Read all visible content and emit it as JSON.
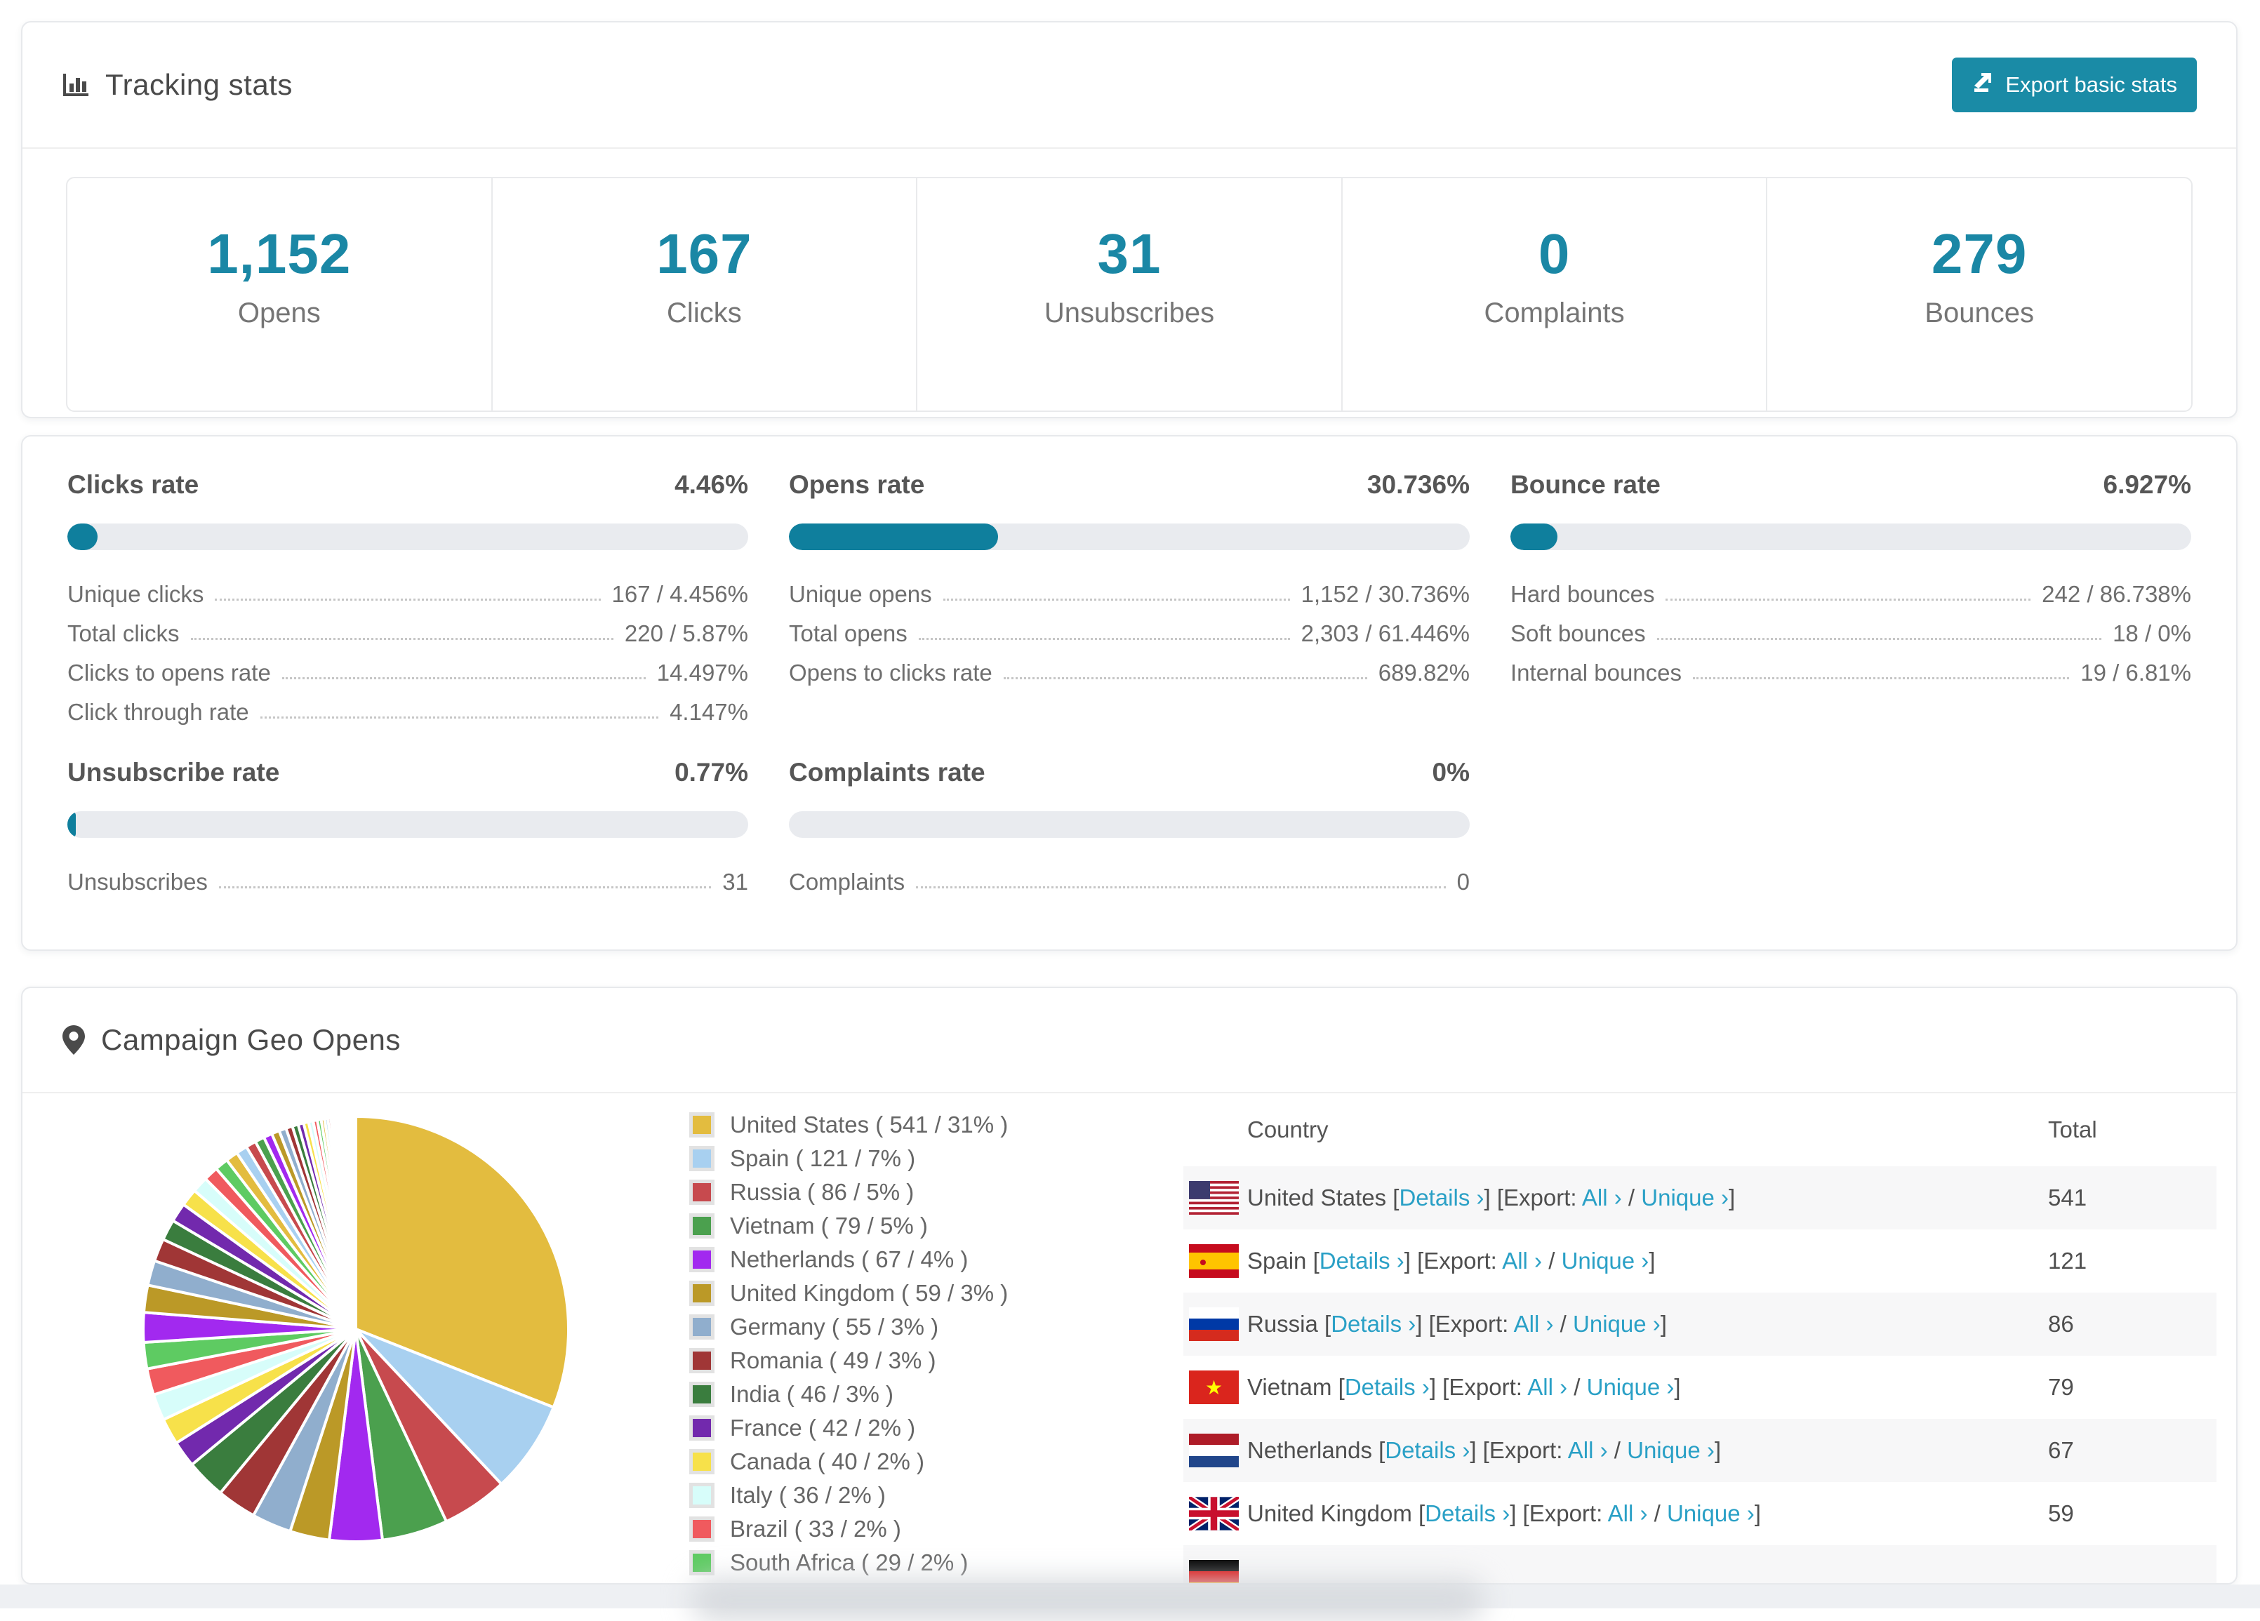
{
  "colors": {
    "accent": "#1a87a5",
    "bar_fill": "#0f7f9d",
    "button_bg": "#1a8ba6",
    "link": "#2aa0c6"
  },
  "header": {
    "title": "Tracking stats",
    "export_label": "Export basic stats"
  },
  "stats": [
    {
      "value": "1,152",
      "label": "Opens"
    },
    {
      "value": "167",
      "label": "Clicks"
    },
    {
      "value": "31",
      "label": "Unsubscribes"
    },
    {
      "value": "0",
      "label": "Complaints"
    },
    {
      "value": "279",
      "label": "Bounces"
    }
  ],
  "rates": [
    {
      "title": "Clicks rate",
      "value": "4.46%",
      "pct": 4.46,
      "rows": [
        {
          "label": "Unique clicks",
          "value": "167 / 4.456%"
        },
        {
          "label": "Total clicks",
          "value": "220 / 5.87%"
        },
        {
          "label": "Clicks to opens rate",
          "value": "14.497%"
        },
        {
          "label": "Click through rate",
          "value": "4.147%"
        }
      ]
    },
    {
      "title": "Opens rate",
      "value": "30.736%",
      "pct": 30.736,
      "rows": [
        {
          "label": "Unique opens",
          "value": "1,152 / 30.736%"
        },
        {
          "label": "Total opens",
          "value": "2,303 / 61.446%"
        },
        {
          "label": "Opens to clicks rate",
          "value": "689.82%"
        }
      ]
    },
    {
      "title": "Bounce rate",
      "value": "6.927%",
      "pct": 6.927,
      "rows": [
        {
          "label": "Hard bounces",
          "value": "242 / 86.738%"
        },
        {
          "label": "Soft bounces",
          "value": "18 / 0%"
        },
        {
          "label": "Internal bounces",
          "value": "19 / 6.81%"
        }
      ]
    },
    {
      "title": "Unsubscribe rate",
      "value": "0.77%",
      "pct": 0.77,
      "rows": [
        {
          "label": "Unsubscribes",
          "value": "31"
        }
      ]
    },
    {
      "title": "Complaints rate",
      "value": "0%",
      "pct": 0,
      "rows": [
        {
          "label": "Complaints",
          "value": "0"
        }
      ]
    }
  ],
  "geo": {
    "title": "Campaign Geo Opens",
    "table": {
      "headers": [
        "Country",
        "Total"
      ],
      "details_label": "Details ›",
      "export_prefix": "Export:",
      "all_label": "All ›",
      "unique_label": "Unique ›",
      "rows": [
        {
          "country": "United States",
          "total": "541",
          "flag": "us"
        },
        {
          "country": "Spain",
          "total": "121",
          "flag": "es"
        },
        {
          "country": "Russia",
          "total": "86",
          "flag": "ru"
        },
        {
          "country": "Vietnam",
          "total": "79",
          "flag": "vn"
        },
        {
          "country": "Netherlands",
          "total": "67",
          "flag": "nl"
        },
        {
          "country": "United Kingdom",
          "total": "59",
          "flag": "gb"
        }
      ],
      "partial_row": {
        "flag": "de"
      }
    }
  },
  "chart_data": {
    "type": "pie",
    "title": "Campaign Geo Opens",
    "legend_position": "right",
    "series": [
      {
        "name": "United States",
        "value": "541",
        "pct": 31,
        "color": "#e3bc3f"
      },
      {
        "name": "Spain",
        "value": "121",
        "pct": 7,
        "color": "#a8d0f0"
      },
      {
        "name": "Russia",
        "value": "86",
        "pct": 5,
        "color": "#c74a4e"
      },
      {
        "name": "Vietnam",
        "value": "79",
        "pct": 5,
        "color": "#4ba04e"
      },
      {
        "name": "Netherlands",
        "value": "67",
        "pct": 4,
        "color": "#a229ef"
      },
      {
        "name": "United Kingdom",
        "value": "59",
        "pct": 3,
        "color": "#bb9927"
      },
      {
        "name": "Germany",
        "value": "55",
        "pct": 3,
        "color": "#90aecd"
      },
      {
        "name": "Romania",
        "value": "49",
        "pct": 3,
        "color": "#a03636"
      },
      {
        "name": "India",
        "value": "46",
        "pct": 3,
        "color": "#3a7d3e"
      },
      {
        "name": "France",
        "value": "42",
        "pct": 2,
        "color": "#7229ad"
      },
      {
        "name": "Canada",
        "value": "40",
        "pct": 2,
        "color": "#f7e14a"
      },
      {
        "name": "Italy",
        "value": "36",
        "pct": 2,
        "color": "#d7fdfa"
      },
      {
        "name": "Brazil",
        "value": "33",
        "pct": 2,
        "color": "#f05a5e"
      },
      {
        "name": "South Africa",
        "value": "29",
        "pct": 2,
        "color": "#5ecb62"
      }
    ],
    "others_total_pct": 26
  }
}
